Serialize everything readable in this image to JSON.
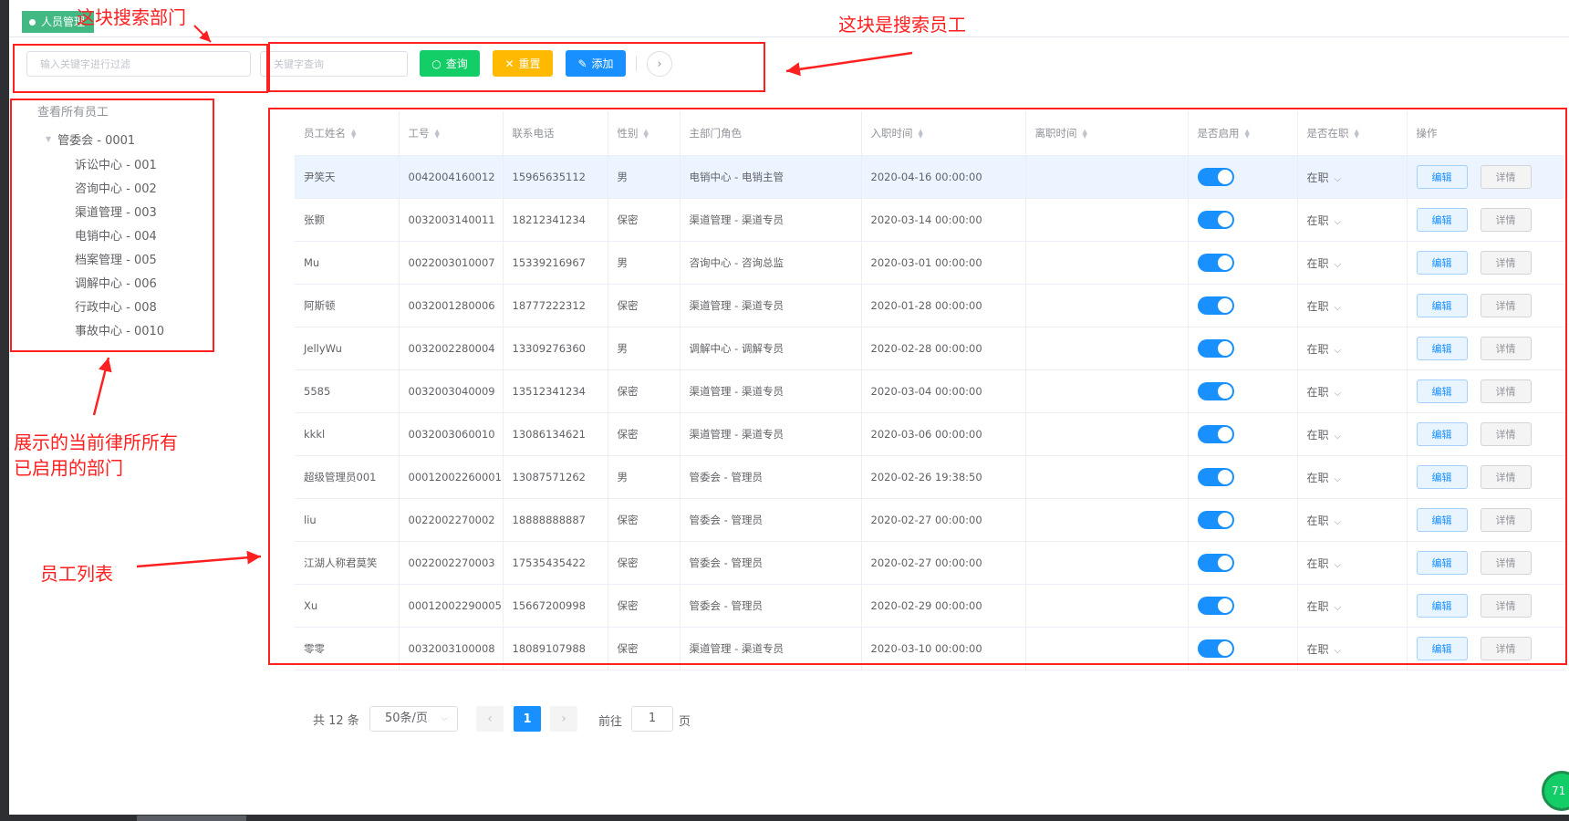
{
  "tag": {
    "label": "人员管理"
  },
  "search_dept": {
    "placeholder": "输入关键字进行过滤"
  },
  "search_emp": {
    "placeholder": "关键字查询",
    "query_label": "查询",
    "reset_label": "重置",
    "add_label": "添加"
  },
  "tree": {
    "title": "查看所有员工",
    "root": "管委会 - 0001",
    "children": [
      "诉讼中心 - 001",
      "咨询中心 - 002",
      "渠道管理 - 003",
      "电销中心 - 004",
      "档案管理 - 005",
      "调解中心 - 006",
      "行政中心 - 008",
      "事故中心 - 0010"
    ]
  },
  "table": {
    "columns": [
      "员工姓名",
      "工号",
      "联系电话",
      "性别",
      "主部门角色",
      "入职时间",
      "离职时间",
      "是否启用",
      "是否在职",
      "操作"
    ],
    "edit_label": "编辑",
    "detail_label": "详情",
    "rows": [
      {
        "name": "尹笑天",
        "no": "0042004160012",
        "phone": "15965635112",
        "gender": "男",
        "role": "电销中心 - 电销主管",
        "join": "2020-04-16 00:00:00",
        "leave": "",
        "enabled": true,
        "status": "在职"
      },
      {
        "name": "张颢",
        "no": "0032003140011",
        "phone": "18212341234",
        "gender": "保密",
        "role": "渠道管理 - 渠道专员",
        "join": "2020-03-14 00:00:00",
        "leave": "",
        "enabled": true,
        "status": "在职"
      },
      {
        "name": "Mu",
        "no": "0022003010007",
        "phone": "15339216967",
        "gender": "男",
        "role": "咨询中心 - 咨询总监",
        "join": "2020-03-01 00:00:00",
        "leave": "",
        "enabled": true,
        "status": "在职"
      },
      {
        "name": "阿斯顿",
        "no": "0032001280006",
        "phone": "18777222312",
        "gender": "保密",
        "role": "渠道管理 - 渠道专员",
        "join": "2020-01-28 00:00:00",
        "leave": "",
        "enabled": true,
        "status": "在职"
      },
      {
        "name": "JellyWu",
        "no": "0032002280004",
        "phone": "13309276360",
        "gender": "男",
        "role": "调解中心 - 调解专员",
        "join": "2020-02-28 00:00:00",
        "leave": "",
        "enabled": true,
        "status": "在职"
      },
      {
        "name": "5585",
        "no": "0032003040009",
        "phone": "13512341234",
        "gender": "保密",
        "role": "渠道管理 - 渠道专员",
        "join": "2020-03-04 00:00:00",
        "leave": "",
        "enabled": true,
        "status": "在职"
      },
      {
        "name": "kkkl",
        "no": "0032003060010",
        "phone": "13086134621",
        "gender": "保密",
        "role": "渠道管理 - 渠道专员",
        "join": "2020-03-06 00:00:00",
        "leave": "",
        "enabled": true,
        "status": "在职"
      },
      {
        "name": "超级管理员001",
        "no": "00012002260001",
        "phone": "13087571262",
        "gender": "男",
        "role": "管委会 - 管理员",
        "join": "2020-02-26 19:38:50",
        "leave": "",
        "enabled": true,
        "status": "在职"
      },
      {
        "name": "liu",
        "no": "0022002270002",
        "phone": "18888888887",
        "gender": "保密",
        "role": "管委会 - 管理员",
        "join": "2020-02-27 00:00:00",
        "leave": "",
        "enabled": true,
        "status": "在职"
      },
      {
        "name": "江湖人称君莫笑",
        "no": "0022002270003",
        "phone": "17535435422",
        "gender": "保密",
        "role": "管委会 - 管理员",
        "join": "2020-02-27 00:00:00",
        "leave": "",
        "enabled": true,
        "status": "在职"
      },
      {
        "name": "Xu",
        "no": "00012002290005",
        "phone": "15667200998",
        "gender": "保密",
        "role": "管委会 - 管理员",
        "join": "2020-02-29 00:00:00",
        "leave": "",
        "enabled": true,
        "status": "在职"
      },
      {
        "name": "零零",
        "no": "0032003100008",
        "phone": "18089107988",
        "gender": "保密",
        "role": "渠道管理 - 渠道专员",
        "join": "2020-03-10 00:00:00",
        "leave": "",
        "enabled": true,
        "status": "在职"
      }
    ]
  },
  "pagination": {
    "total_text": "共 12 条",
    "page_size": "50条/页",
    "current_page": "1",
    "goto_prefix": "前往",
    "goto_value": "1",
    "goto_suffix": "页"
  },
  "annotations": {
    "dept_search": "这块搜索部门",
    "emp_search": "这块是搜索员工",
    "dept_tree_line1": "展示的当前律所所有",
    "dept_tree_line2": "已启用的部门",
    "emp_list": "员工列表"
  },
  "floating_badge": "71",
  "colors": {
    "primary": "#1890ff",
    "success": "#13ce66",
    "warning": "#ffba00",
    "annotation": "#ff2020"
  }
}
